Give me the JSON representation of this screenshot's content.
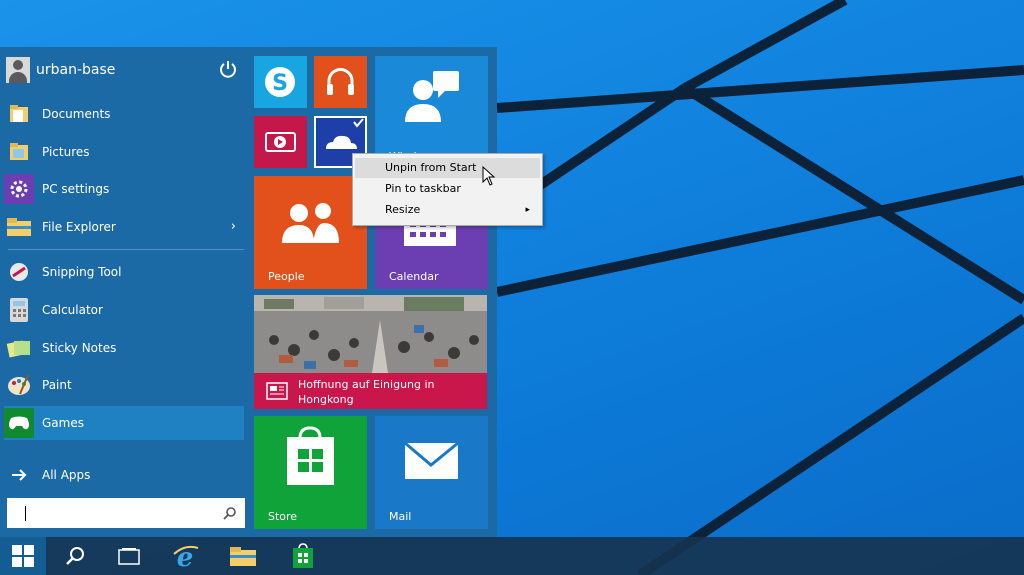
{
  "user": {
    "name": "urban-base"
  },
  "left_menu": {
    "pinned": [
      {
        "label": "Documents",
        "icon": "documents-folder-icon"
      },
      {
        "label": "Pictures",
        "icon": "pictures-folder-icon"
      },
      {
        "label": "PC settings",
        "icon": "gear-icon"
      },
      {
        "label": "File Explorer",
        "icon": "file-explorer-icon",
        "has_submenu": true
      }
    ],
    "recent": [
      {
        "label": "Snipping Tool",
        "icon": "snipping-tool-icon"
      },
      {
        "label": "Calculator",
        "icon": "calculator-icon"
      },
      {
        "label": "Sticky Notes",
        "icon": "sticky-notes-icon"
      },
      {
        "label": "Paint",
        "icon": "paint-icon"
      },
      {
        "label": "Games",
        "icon": "games-controller-icon",
        "selected": true
      }
    ],
    "all_apps": "All Apps",
    "search": {
      "value": "",
      "placeholder": ""
    }
  },
  "tiles": {
    "windows": "Windows",
    "people": "People",
    "calendar": "Calendar",
    "news": "Hoffnung auf Einigung in Hongkong",
    "store": "Store",
    "mail": "Mail"
  },
  "context_menu": {
    "items": [
      {
        "label": "Unpin from Start",
        "hover": true
      },
      {
        "label": "Pin to taskbar"
      },
      {
        "label": "Resize",
        "has_submenu": true
      }
    ]
  },
  "colors": {
    "desktop_blue": "#0d7bd8",
    "start_menu": "#1c6aa5",
    "skype": "#18a6e3",
    "music": "#e2511c",
    "video": "#c5184a",
    "onedrive": "#1f3fa8",
    "windows_tile": "#1a8ad8",
    "people": "#e2511c",
    "calendar": "#6b3fb2",
    "news_caption": "#c9174c",
    "store": "#0fa33a",
    "mail": "#1a78c8"
  }
}
